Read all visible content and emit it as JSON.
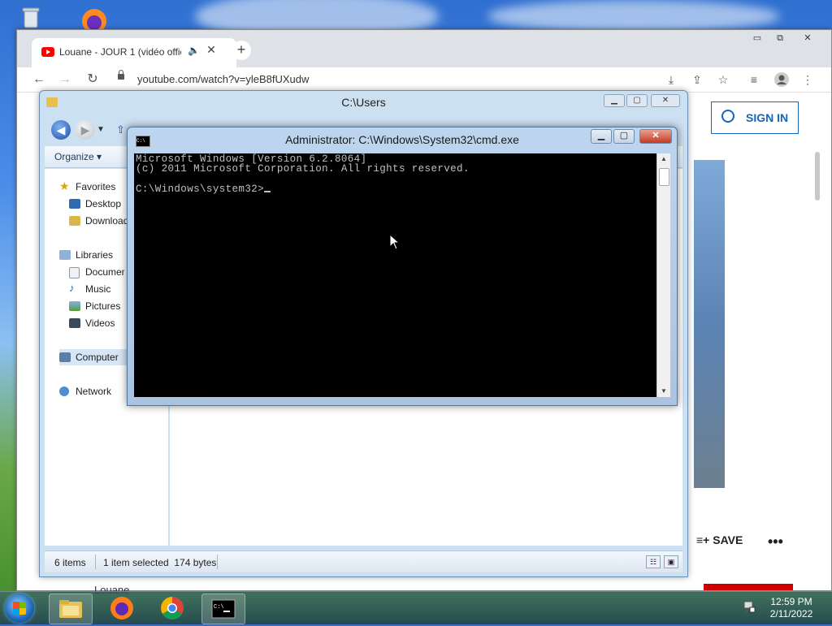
{
  "chrome": {
    "tab_title": "Louane - JOUR 1 (vidéo offic",
    "tab_speaker_icon": "speaker-icon",
    "tab_close": "✕",
    "new_tab": "+",
    "url": "youtube.com/watch?v=yleB8fUXudw",
    "window_controls": {
      "minimize": "▭",
      "restore": "⧉",
      "close": "✕"
    }
  },
  "youtube": {
    "sign_in": "SIGN IN",
    "save": "SAVE",
    "more": "•••",
    "channel_partial": "Louane"
  },
  "explorer": {
    "title": "C:\\Users",
    "organize": "Organize ▾",
    "nav": {
      "favorites": "Favorites",
      "desktop": "Desktop",
      "downloads": "Downloads",
      "libraries": "Libraries",
      "documents": "Documents",
      "music": "Music",
      "pictures": "Pictures",
      "videos": "Videos",
      "computer": "Computer",
      "network": "Network"
    },
    "status": {
      "items": "6 items",
      "selected": "1 item selected  174 bytes"
    }
  },
  "cmd": {
    "title": "Administrator: C:\\Windows\\System32\\cmd.exe",
    "line1": "Microsoft Windows [Version 6.2.8064]",
    "line2": "(c) 2011 Microsoft Corporation. All rights reserved.",
    "line3": "",
    "prompt": "C:\\Windows\\system32>"
  },
  "taskbar": {
    "time": "12:59 PM",
    "date": "2/11/2022",
    "apps": [
      "windows-explorer",
      "firefox",
      "chrome",
      "command-prompt"
    ]
  }
}
